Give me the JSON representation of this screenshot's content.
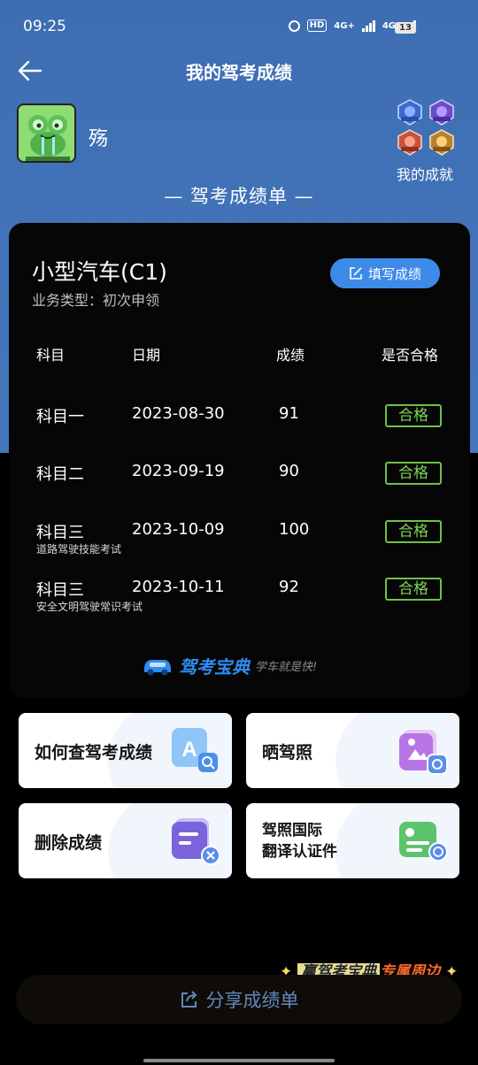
{
  "status": {
    "time": "09:25",
    "hd": "HD",
    "net1": "4G+",
    "net2": "4G",
    "battery": "13"
  },
  "header": {
    "title": "我的驾考成绩"
  },
  "user": {
    "name": "殇",
    "achievements_label": "我的成就"
  },
  "sheet_title": "— 驾考成绩单 —",
  "card": {
    "license_type": "小型汽车(C1)",
    "business_type": "业务类型：初次申领",
    "fill_button": "填写成绩",
    "columns": [
      "科目",
      "日期",
      "成绩",
      "是否合格"
    ],
    "rows": [
      {
        "subject": "科目一",
        "date": "2023-08-30",
        "score": "91",
        "result": "合格",
        "note": ""
      },
      {
        "subject": "科目二",
        "date": "2023-09-19",
        "score": "90",
        "result": "合格",
        "note": ""
      },
      {
        "subject": "科目三",
        "date": "2023-10-09",
        "score": "100",
        "result": "合格",
        "note": "道路驾驶技能考试"
      },
      {
        "subject": "科目三",
        "date": "2023-10-11",
        "score": "92",
        "result": "合格",
        "note": "安全文明驾驶常识考试"
      }
    ],
    "brand_name": "驾考宝典",
    "brand_slogan": "学车就是快!"
  },
  "tiles": {
    "query": "如何查驾考成绩",
    "show_license": "晒驾照",
    "delete": "删除成绩",
    "intl_line1": "驾照国际",
    "intl_line2": "翻译认证件"
  },
  "bottom": {
    "share": "分享成绩单",
    "promo_a": "赢驾考宝典",
    "promo_b": "专属周边"
  },
  "colors": {
    "header_blue": "#4577bc",
    "accent_blue": "#3d8be8",
    "pass_green": "#6fc04a"
  }
}
